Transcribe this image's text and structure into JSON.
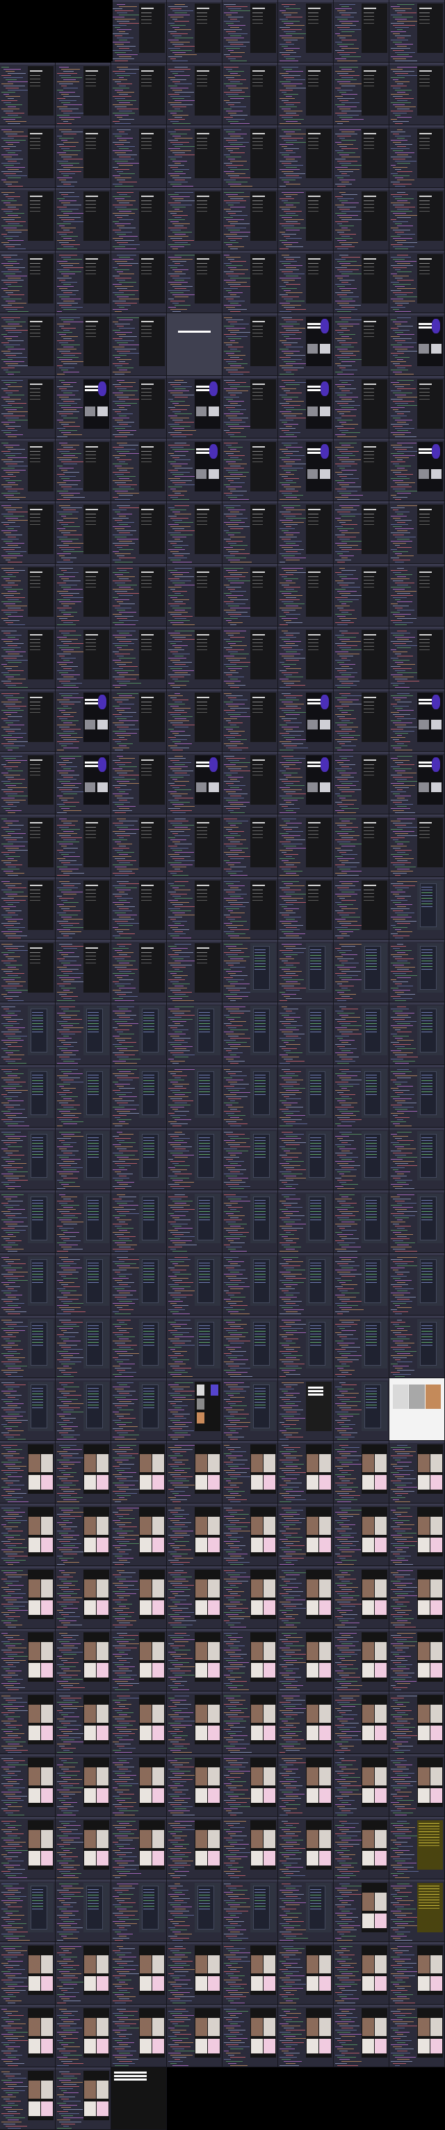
{
  "window": {
    "title": ""
  },
  "theme": {
    "editor_bg": "#2b2b3a",
    "gutter_bg": "#232330",
    "accent": "#4b2fb8",
    "syntax_colors": [
      "#6e7ab0",
      "#5fa66a",
      "#c678dd",
      "#d19a66",
      "#9aa5ce",
      "#e06c75"
    ]
  },
  "grid": {
    "columns": 8,
    "rows": 34,
    "empty_cells": [
      0,
      1
    ]
  },
  "frames": [
    "dark",
    "dark",
    "dark",
    "dark",
    "dark",
    "dark",
    "dark",
    "dark",
    "dark",
    "dark",
    "dark",
    "dark",
    "dark",
    "dark",
    "dark",
    "dark",
    "dark",
    "dark",
    "dark",
    "dark",
    "dark",
    "dark",
    "dark",
    "dark",
    "dark",
    "dark",
    "dark",
    "dark",
    "dark",
    "dark",
    "dark",
    "dark",
    "dark",
    "dark",
    "dark",
    "dark",
    "dark",
    "dark",
    "dark",
    "dark",
    "dark",
    "fullgrey",
    "dark",
    "hero",
    "dark",
    "hero",
    "dark",
    "hero",
    "dark",
    "hero",
    "dark",
    "hero",
    "dark",
    "dark",
    "dark",
    "dark",
    "dark",
    "hero",
    "dark",
    "hero",
    "dark",
    "hero",
    "dark",
    "dark",
    "dark",
    "dark",
    "dark",
    "dark",
    "dark",
    "dark",
    "dark",
    "dark",
    "dark",
    "dark",
    "dark",
    "dark",
    "dark",
    "dark",
    "dark",
    "dark",
    "dark",
    "dark",
    "dark",
    "dark",
    "dark",
    "dark",
    "dark",
    "hero",
    "dark",
    "dark",
    "dark",
    "hero",
    "dark",
    "hero",
    "dark",
    "hero",
    "dark",
    "hero",
    "dark",
    "hero",
    "dark",
    "hero",
    "dark",
    "dark",
    "dark",
    "dark",
    "dark",
    "dark",
    "dark",
    "dark",
    "dark",
    "dark",
    "dark",
    "dark",
    "dark",
    "dark",
    "dark",
    "list",
    "dark",
    "dark",
    "dark",
    "dark",
    "list",
    "list",
    "list",
    "list",
    "list",
    "list",
    "list",
    "list",
    "list",
    "list",
    "list",
    "list",
    "list",
    "list",
    "list",
    "list",
    "list",
    "list",
    "list",
    "list",
    "list",
    "list",
    "list",
    "list",
    "list",
    "list",
    "list",
    "list",
    "list",
    "list",
    "list",
    "list",
    "list",
    "list",
    "list",
    "list",
    "list",
    "list",
    "list",
    "list",
    "list",
    "list",
    "list",
    "list",
    "list",
    "list",
    "list",
    "list",
    "list",
    "list",
    "list",
    "list",
    "list",
    "list",
    "list",
    "stack",
    "list",
    "dark2",
    "list",
    "fullwhite",
    "photo",
    "photo",
    "photo",
    "photo",
    "photo",
    "photo",
    "photo",
    "photo",
    "photo",
    "photo",
    "photo",
    "photo",
    "photo",
    "photo",
    "photo",
    "photo",
    "photo",
    "photo",
    "photo",
    "photo",
    "photo",
    "photo",
    "photo",
    "photo",
    "photo",
    "photo",
    "photo",
    "photo",
    "photo",
    "photo",
    "photo",
    "photo",
    "photo",
    "photo",
    "photo",
    "photo",
    "photo",
    "photo",
    "photo",
    "photo",
    "photo",
    "photo",
    "photo",
    "photo",
    "photo",
    "photo",
    "photo",
    "photo",
    "photo",
    "photo",
    "photo",
    "photo",
    "photo",
    "photo",
    "photo",
    "yellow",
    "list",
    "list",
    "list",
    "list",
    "list",
    "list",
    "photo",
    "yellow",
    "photo",
    "photo",
    "photo",
    "photo",
    "photo",
    "photo",
    "photo",
    "photo",
    "photo",
    "photo",
    "photo",
    "photo",
    "photo",
    "photo",
    "photo",
    "photo",
    "photo",
    "photo",
    "dark2full",
    "none",
    "none",
    "none",
    "none",
    "none"
  ]
}
